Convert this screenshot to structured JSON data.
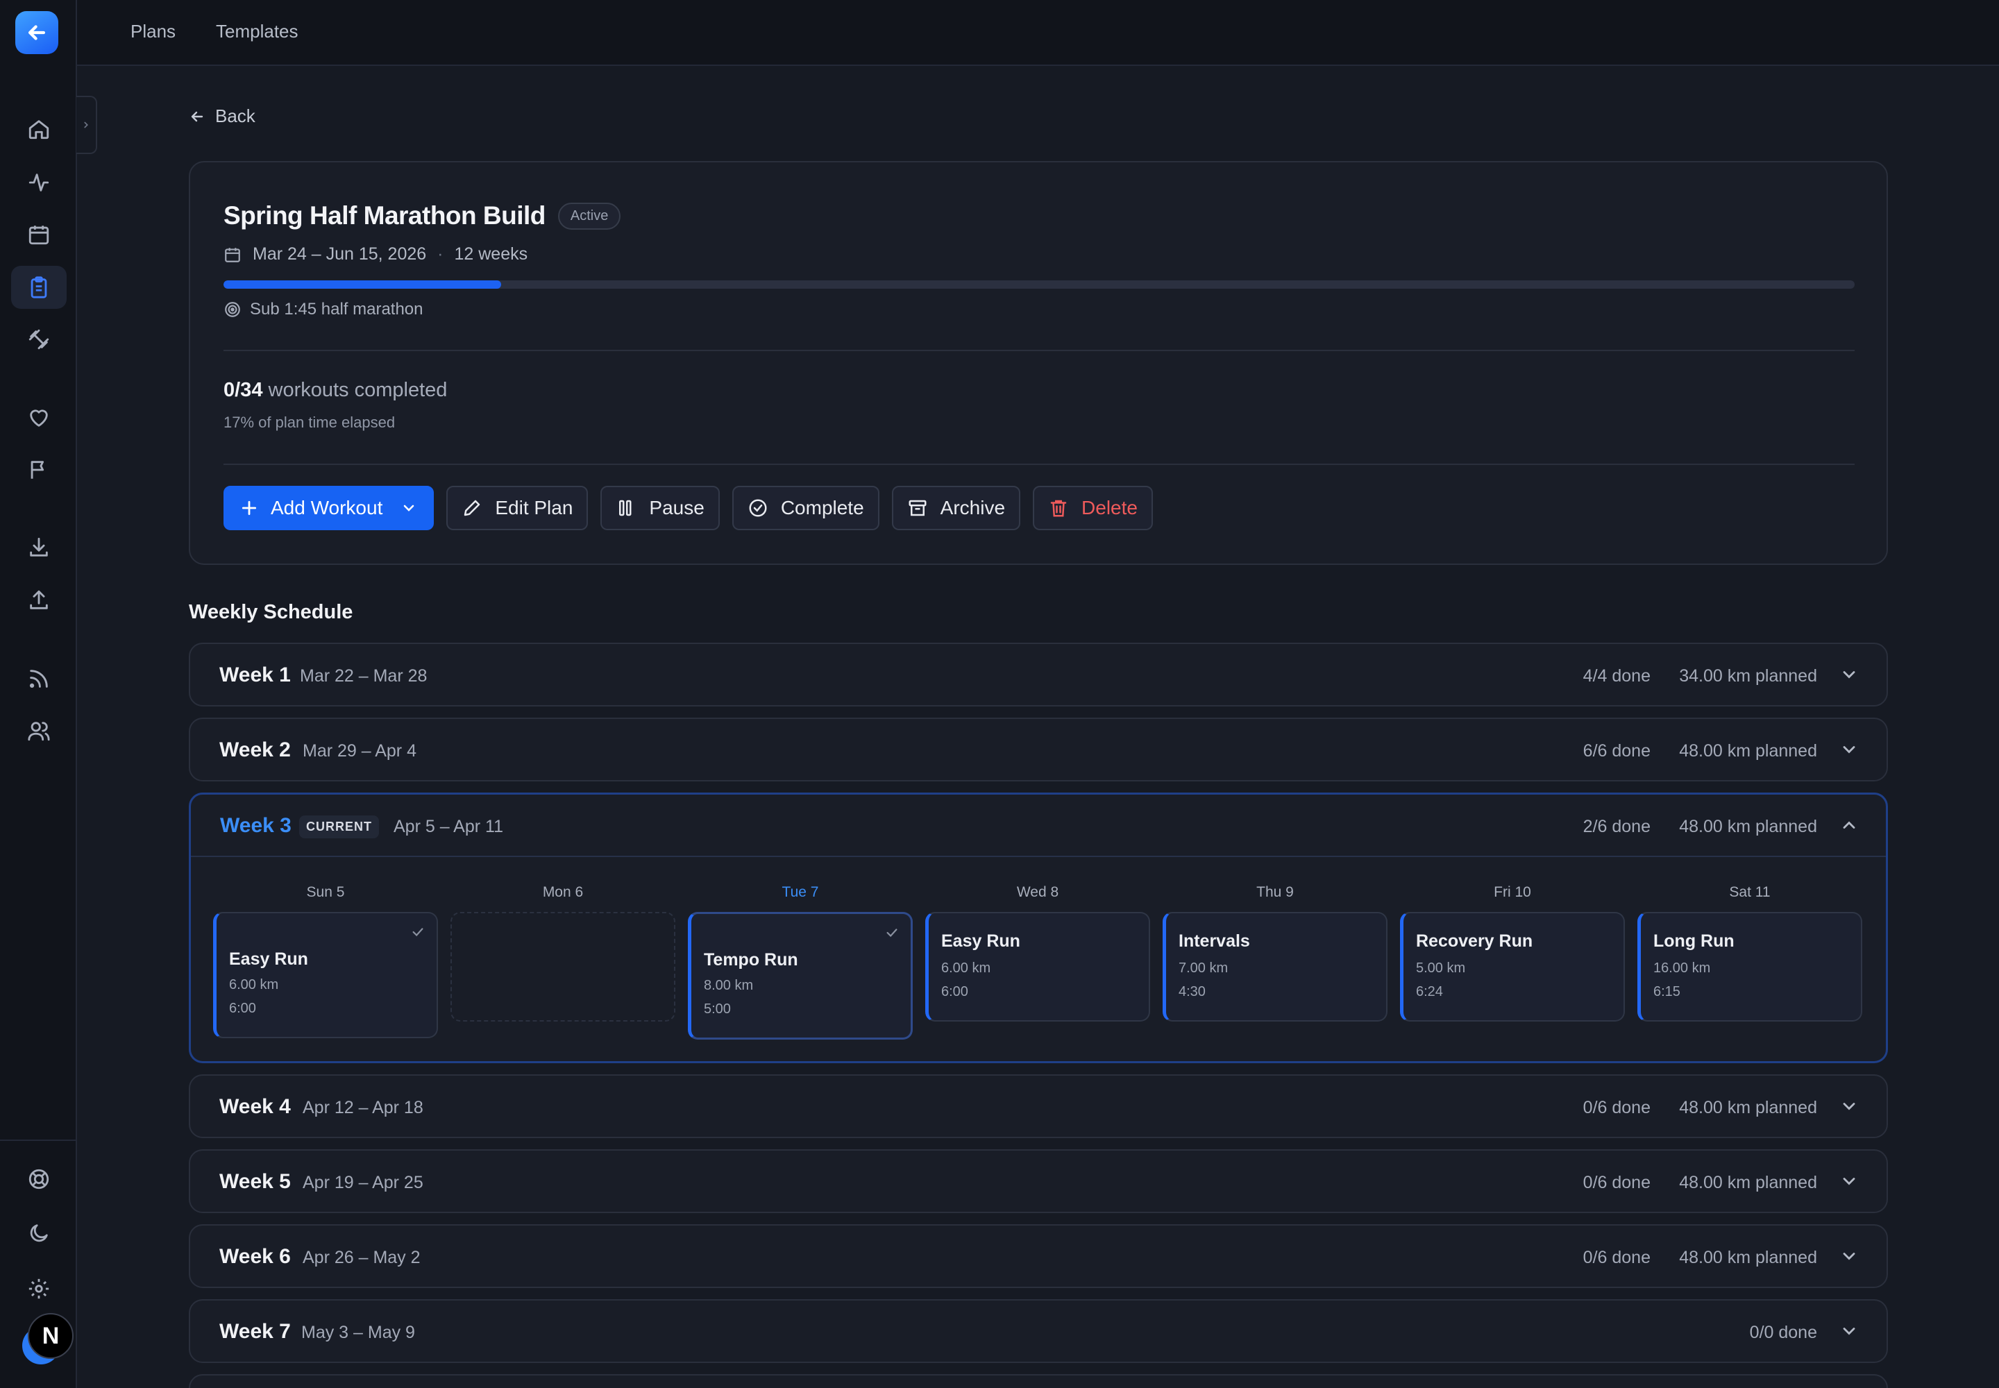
{
  "nav": {
    "tabs": [
      "Plans",
      "Templates"
    ],
    "avatar_initial": "N"
  },
  "back_label": "Back",
  "plan": {
    "title": "Spring Half Marathon Build",
    "status": "Active",
    "date_range": "Mar 24 – Jun 15, 2026",
    "separator": "·",
    "duration": "12 weeks",
    "progress_fraction": 0.17,
    "goal": "Sub 1:45 half marathon",
    "completed_count": "0/34",
    "completed_suffix": "workouts completed",
    "elapsed": "17% of plan time elapsed"
  },
  "actions": {
    "add_workout": "Add Workout",
    "edit_plan": "Edit Plan",
    "pause": "Pause",
    "complete": "Complete",
    "archive": "Archive",
    "delete": "Delete"
  },
  "schedule_title": "Weekly Schedule",
  "weeks": [
    {
      "label": "Week 1",
      "range": "Mar 22 – Mar 28",
      "done": "4/4 done",
      "planned": "34.00 km planned"
    },
    {
      "label": "Week 2",
      "range": "Mar 29 – Apr 4",
      "done": "6/6 done",
      "planned": "48.00 km planned"
    },
    {
      "label": "Week 3",
      "badge": "CURRENT",
      "range": "Apr 5 – Apr 11",
      "done": "2/6 done",
      "planned": "48.00 km planned"
    },
    {
      "label": "Week 4",
      "range": "Apr 12 – Apr 18",
      "done": "0/6 done",
      "planned": "48.00 km planned"
    },
    {
      "label": "Week 5",
      "range": "Apr 19 – Apr 25",
      "done": "0/6 done",
      "planned": "48.00 km planned"
    },
    {
      "label": "Week 6",
      "range": "Apr 26 – May 2",
      "done": "0/6 done",
      "planned": "48.00 km planned"
    },
    {
      "label": "Week 7",
      "range": "May 3 – May 9",
      "done": "0/0 done",
      "planned": ""
    }
  ],
  "days": [
    {
      "day": "Sun 5",
      "workout": "Easy Run",
      "distance": "6.00 km",
      "pace": "6:00",
      "done": true
    },
    {
      "day": "Mon 6"
    },
    {
      "day": "Tue 7",
      "today": true,
      "workout": "Tempo Run",
      "distance": "8.00 km",
      "pace": "5:00",
      "done": true
    },
    {
      "day": "Wed 8",
      "workout": "Easy Run",
      "distance": "6.00 km",
      "pace": "6:00"
    },
    {
      "day": "Thu 9",
      "workout": "Intervals",
      "distance": "7.00 km",
      "pace": "4:30"
    },
    {
      "day": "Fri 10",
      "workout": "Recovery Run",
      "distance": "5.00 km",
      "pace": "6:24"
    },
    {
      "day": "Sat 11",
      "workout": "Long Run",
      "distance": "16.00 km",
      "pace": "6:15"
    }
  ],
  "colors": {
    "accent": "#1763f3",
    "current": "#3b8ef7",
    "danger": "#ef5b5b"
  }
}
